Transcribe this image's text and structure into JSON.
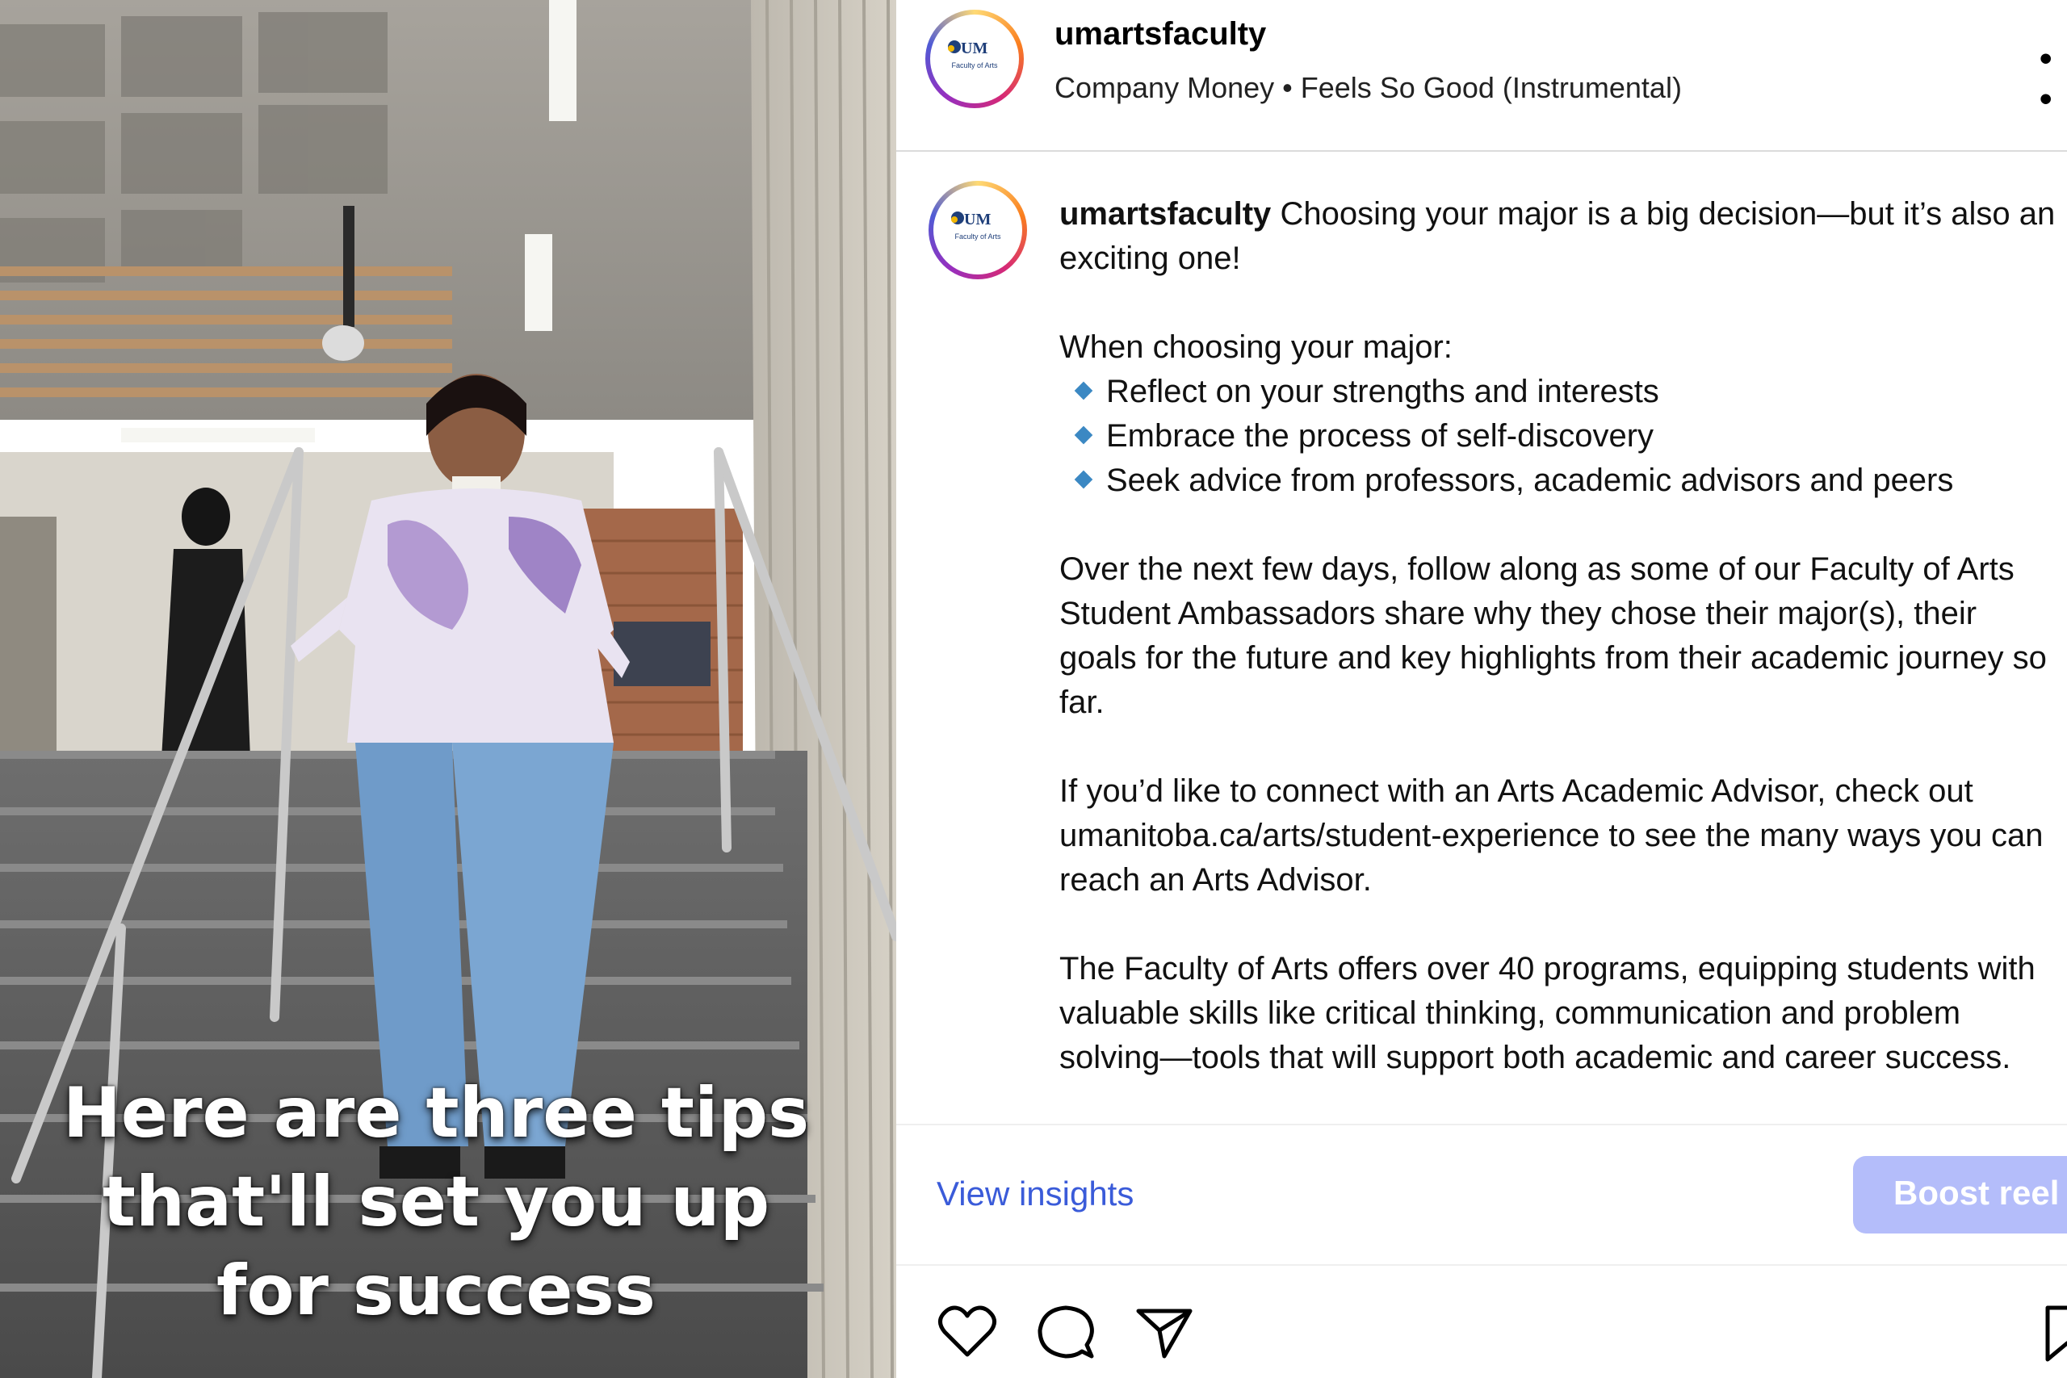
{
  "video": {
    "caption_lines": [
      "Here are three tips",
      "that'll set you up",
      "for success"
    ]
  },
  "header": {
    "username": "umartsfaculty",
    "audio": "Company Money • Feels So Good (Instrumental)",
    "logo_text": "UM",
    "logo_subtext": "Faculty of Arts",
    "more_icon": "more-options-icon"
  },
  "post": {
    "username": "umartsfaculty",
    "intro": "Choosing your major is a big decision—but it’s also an exciting one!",
    "list_heading": "When choosing your major:",
    "bullets": [
      "Reflect on your strengths and interests",
      "Embrace the process of self-discovery",
      "Seek advice from professors, academic advisors and peers"
    ],
    "paragraph2": "Over the next few days, follow along as some of our Faculty of Arts Student Ambassadors share why they chose their major(s), their goals for the future and key highlights from their academic journey so far.",
    "paragraph3": "If you’d like to connect with an Arts Academic Advisor, check out umanitoba.ca/arts/student-experience to see the many ways you can reach an Arts Advisor.",
    "paragraph4": "The Faculty of Arts offers over 40 programs, equipping students with valuable skills like critical thinking, communication and problem solving—tools that will support both academic and career success."
  },
  "actions": {
    "view_insights": "View insights",
    "boost": "Boost reel",
    "icons": [
      "heart-icon",
      "comment-icon",
      "share-icon",
      "bookmark-icon"
    ]
  },
  "colors": {
    "link": "#3a5bd9",
    "boost_bg": "#b4bdfa",
    "bullet": "#3b88c3"
  }
}
